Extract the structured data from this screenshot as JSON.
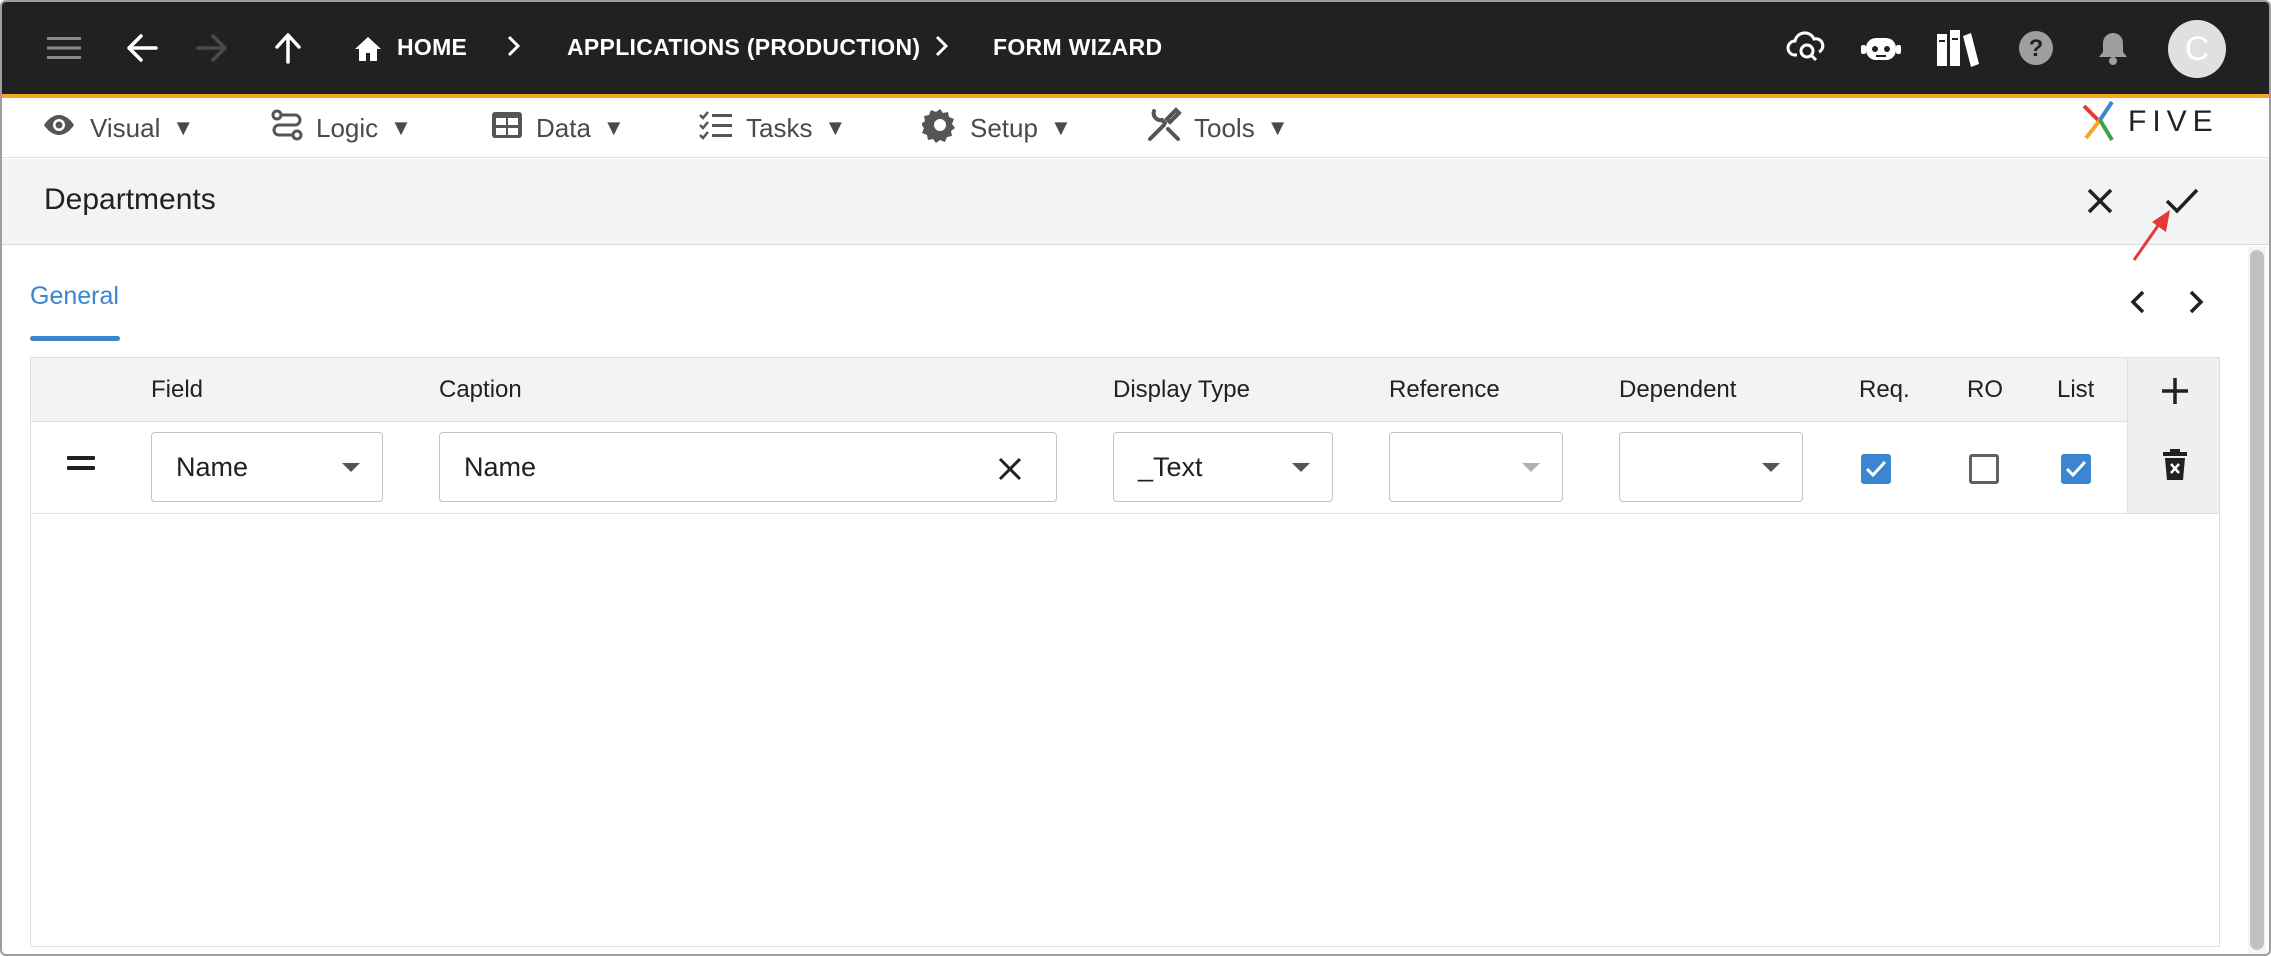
{
  "appbar": {
    "breadcrumbs": [
      "HOME",
      "APPLICATIONS (PRODUCTION)",
      "FORM WIZARD"
    ],
    "icons": [
      "menu-icon",
      "back-icon",
      "forward-icon",
      "up-icon",
      "home-icon",
      "cloud-search-icon",
      "chatbot-icon",
      "library-icon",
      "help-icon",
      "notifications-icon"
    ],
    "avatar_letter": "C",
    "accent_color": "#f5a623",
    "background_color": "#212121"
  },
  "menubar": {
    "items": [
      {
        "label": "Visual",
        "icon": "eye-icon"
      },
      {
        "label": "Logic",
        "icon": "logic-icon"
      },
      {
        "label": "Data",
        "icon": "table-icon"
      },
      {
        "label": "Tasks",
        "icon": "tasks-icon"
      },
      {
        "label": "Setup",
        "icon": "gear-icon"
      },
      {
        "label": "Tools",
        "icon": "tools-icon"
      }
    ],
    "dropdown_symbol": "▼",
    "logo_text": "FIVE"
  },
  "form": {
    "title": "Departments",
    "tabs": [
      {
        "label": "General",
        "active": true
      }
    ]
  },
  "grid": {
    "columns": [
      "Field",
      "Caption",
      "Display Type",
      "Reference",
      "Dependent",
      "Req.",
      "RO",
      "List"
    ],
    "rows": [
      {
        "field": "Name",
        "caption": "Name",
        "display_type": "_Text",
        "reference": "",
        "dependent": "",
        "req": true,
        "ro": false,
        "list": true
      }
    ]
  },
  "colors": {
    "accent": "#3a86d1",
    "annotation": "#e53935"
  }
}
